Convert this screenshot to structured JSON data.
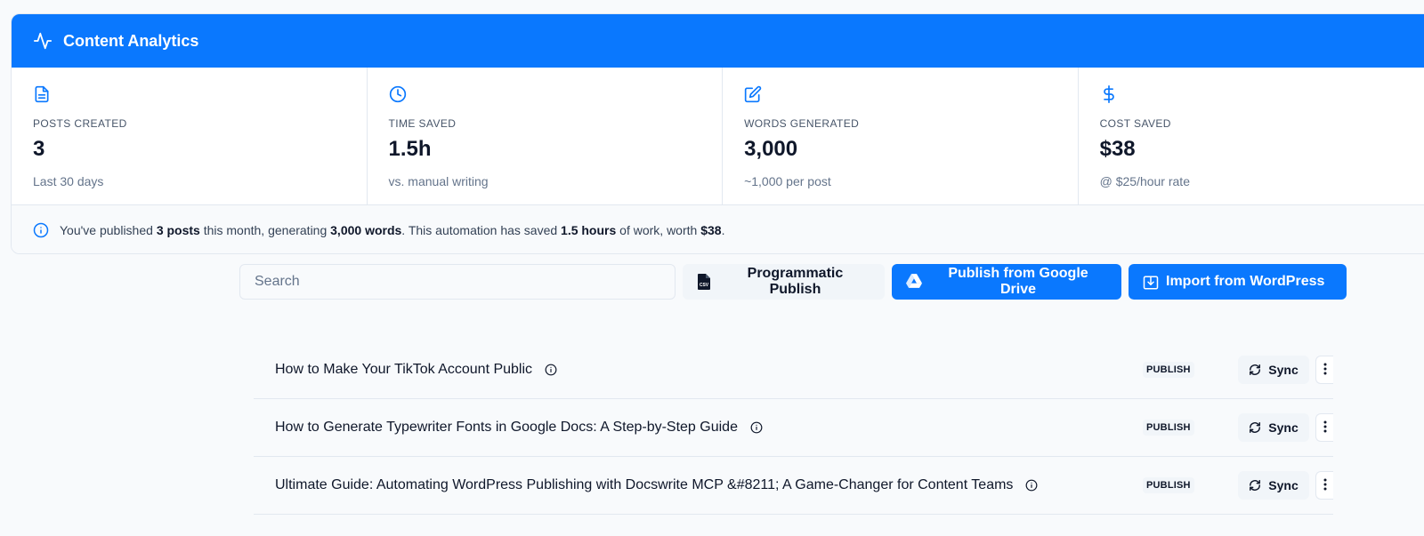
{
  "analytics": {
    "title": "Content Analytics",
    "stats": [
      {
        "icon": "document-icon",
        "label": "POSTS CREATED",
        "value": "3",
        "sub": "Last 30 days"
      },
      {
        "icon": "clock-icon",
        "label": "TIME SAVED",
        "value": "1.5h",
        "sub": "vs. manual writing"
      },
      {
        "icon": "edit-icon",
        "label": "WORDS GENERATED",
        "value": "3,000",
        "sub": "~1,000 per post"
      },
      {
        "icon": "dollar-icon",
        "label": "COST SAVED",
        "value": "$38",
        "sub": "@ $25/hour rate"
      }
    ],
    "summary": {
      "part1": "You've published ",
      "posts": "3 posts",
      "part2": " this month, generating ",
      "words": "3,000 words",
      "part3": ". This automation has saved ",
      "hours": "1.5 hours",
      "part4": " of work, worth ",
      "cost": "$38",
      "part5": "."
    }
  },
  "toolbar": {
    "search_placeholder": "Search",
    "search_value": "",
    "programmatic_label": "Programmatic Publish",
    "gdrive_label": "Publish from Google Drive",
    "wordpress_label": "Import from WordPress"
  },
  "posts": [
    {
      "title": "How to Make Your TikTok Account Public",
      "status": "PUBLISH",
      "sync_label": "Sync"
    },
    {
      "title": "How to Generate Typewriter Fonts in Google Docs: A Step-by-Step Guide",
      "status": "PUBLISH",
      "sync_label": "Sync"
    },
    {
      "title": "Ultimate Guide: Automating WordPress Publishing with Docswrite MCP &#8211; A Game-Changer for Content Teams",
      "status": "PUBLISH",
      "sync_label": "Sync"
    }
  ],
  "colors": {
    "accent": "#0a78fe",
    "border": "#e2e8f0",
    "muted_bg": "#f1f5f9"
  }
}
